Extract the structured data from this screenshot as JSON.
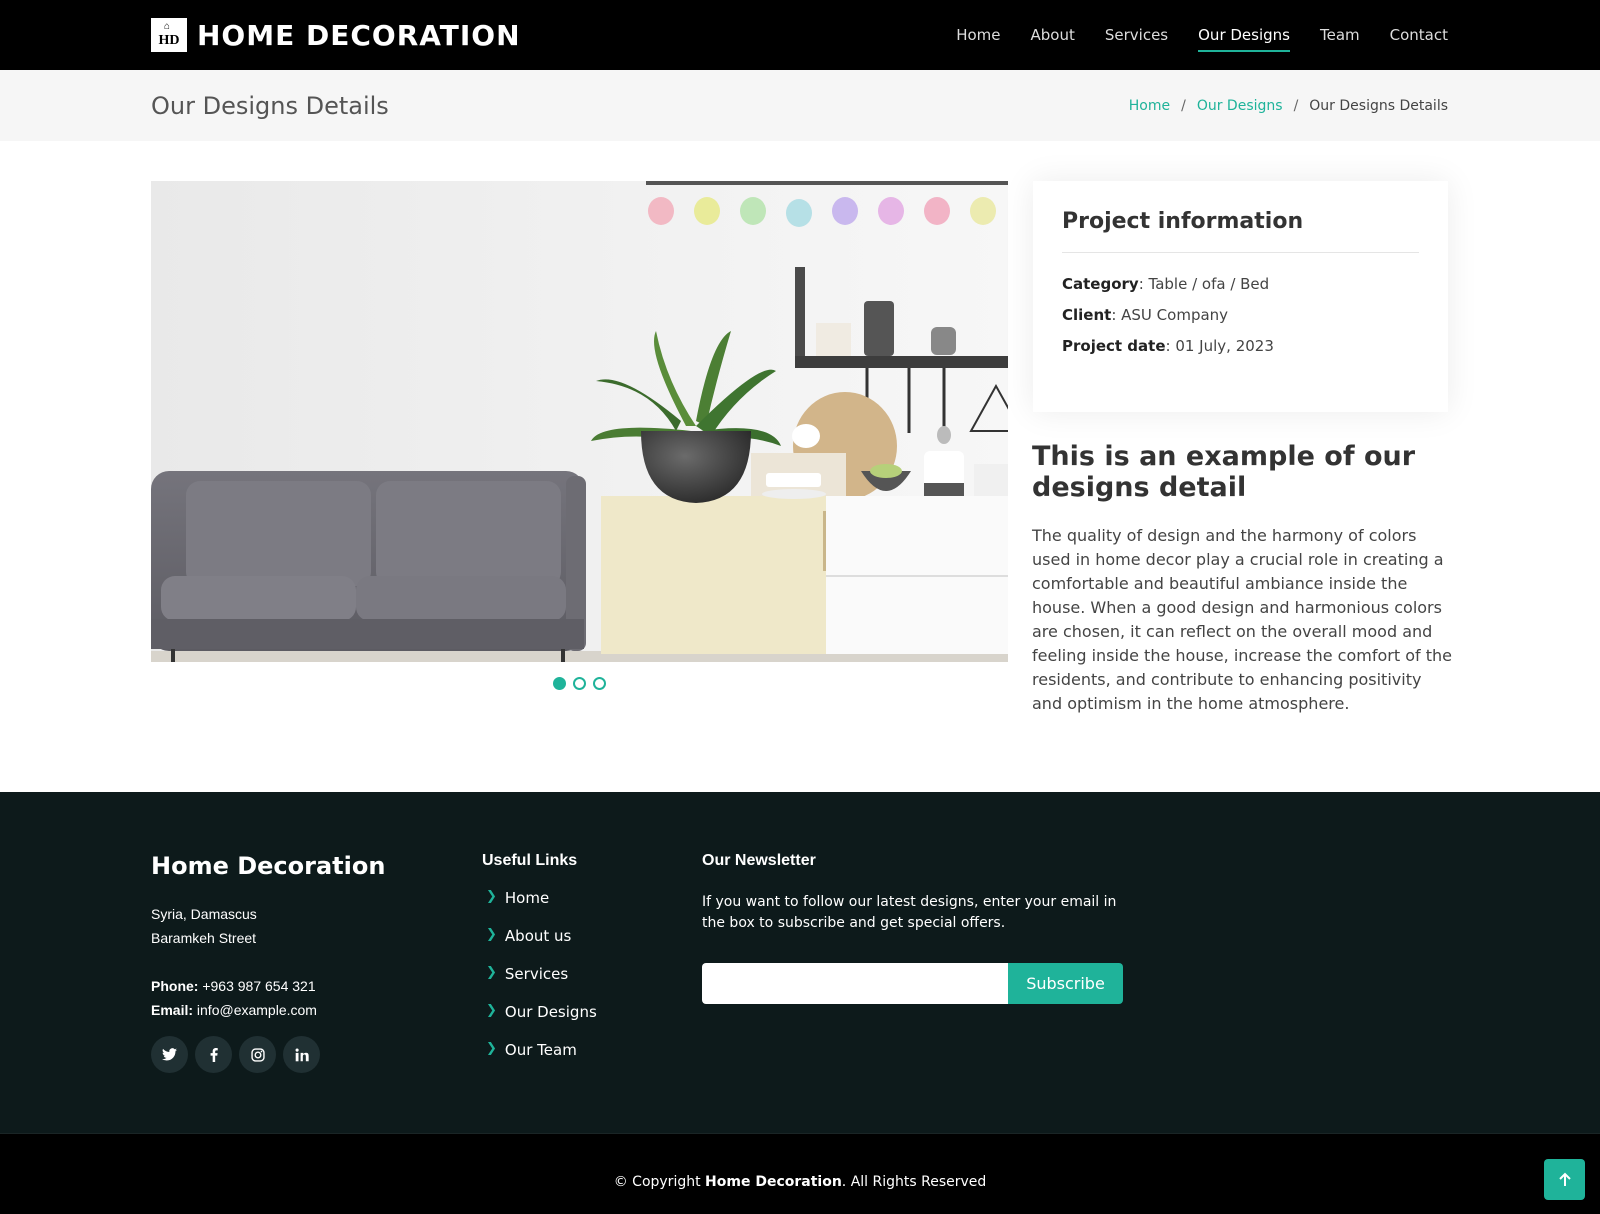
{
  "header": {
    "logo_badge": "HD",
    "logo_text": "HOME DECORATION",
    "nav": [
      {
        "label": "Home",
        "active": false
      },
      {
        "label": "About",
        "active": false
      },
      {
        "label": "Services",
        "active": false
      },
      {
        "label": "Our Designs",
        "active": true
      },
      {
        "label": "Team",
        "active": false
      },
      {
        "label": "Contact",
        "active": false
      }
    ]
  },
  "breadcrumb": {
    "title": "Our Designs Details",
    "items": [
      "Home",
      "Our Designs",
      "Our Designs Details"
    ]
  },
  "slider": {
    "slides": 3,
    "active_slide": 1
  },
  "project_info": {
    "title": "Project information",
    "category_label": "Category",
    "category_value": ": Table / ofa / Bed",
    "client_label": "Client",
    "client_value": ": ASU Company",
    "date_label": "Project date",
    "date_value": ": 01 July, 2023"
  },
  "description": {
    "title": "This is an example of our designs detail",
    "text": "The quality of design and the harmony of colors used in home decor play a crucial role in creating a comfortable and beautiful ambiance inside the house. When a good design and harmonious colors are chosen, it can reflect on the overall mood and feeling inside the house, increase the comfort of the residents, and contribute to enhancing positivity and optimism in the home atmosphere."
  },
  "footer": {
    "brand": "Home Decoration",
    "address_line1": "Syria, Damascus",
    "address_line2": "Baramkeh Street",
    "phone_label": "Phone:",
    "phone_value": " +963 987 654 321",
    "email_label": "Email:",
    "email_value": " info@example.com",
    "socials": [
      "twitter-icon",
      "facebook-icon",
      "instagram-icon",
      "linkedin-icon"
    ],
    "links_title": "Useful Links",
    "links": [
      "Home",
      "About us",
      "Services",
      "Our Designs",
      "Our Team"
    ],
    "newsletter_title": "Our Newsletter",
    "newsletter_text": "If you want to follow our latest designs, enter your email in the box to subscribe and get special offers.",
    "email_input_value": "",
    "subscribe_label": "Subscribe"
  },
  "copyright": {
    "prefix": "© Copyright ",
    "brand": "Home Decoration",
    "suffix": ". All Rights Reserved"
  },
  "colors": {
    "accent": "#1fb39a",
    "header_bg": "#000000",
    "footer_bg": "#0d1a1b"
  }
}
